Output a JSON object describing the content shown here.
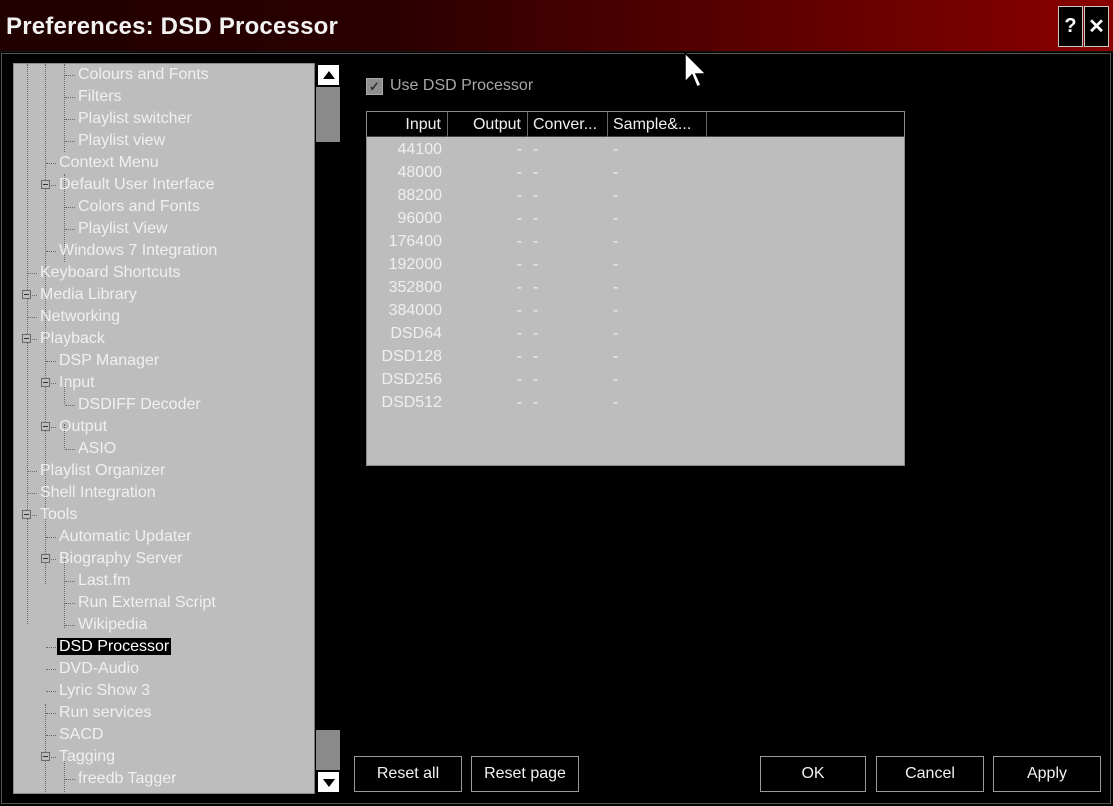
{
  "window": {
    "title": "Preferences: DSD Processor",
    "help_label": "?",
    "close_label": "✕"
  },
  "tree": {
    "items": [
      {
        "label": "Colours and Fonts",
        "selected": false
      },
      {
        "label": "Filters",
        "selected": false
      },
      {
        "label": "Playlist switcher",
        "selected": false
      },
      {
        "label": "Playlist view",
        "selected": false
      },
      {
        "label": "Context Menu",
        "selected": false
      },
      {
        "label": "Default User Interface",
        "selected": false
      },
      {
        "label": "Colors and Fonts",
        "selected": false
      },
      {
        "label": "Playlist View",
        "selected": false
      },
      {
        "label": "Windows 7 Integration",
        "selected": false
      },
      {
        "label": "Keyboard Shortcuts",
        "selected": false
      },
      {
        "label": "Media Library",
        "selected": false
      },
      {
        "label": "Networking",
        "selected": false
      },
      {
        "label": "Playback",
        "selected": false
      },
      {
        "label": "DSP Manager",
        "selected": false
      },
      {
        "label": "Input",
        "selected": false
      },
      {
        "label": "DSDIFF Decoder",
        "selected": false
      },
      {
        "label": "Output",
        "selected": false
      },
      {
        "label": "ASIO",
        "selected": false
      },
      {
        "label": "Playlist Organizer",
        "selected": false
      },
      {
        "label": "Shell Integration",
        "selected": false
      },
      {
        "label": "Tools",
        "selected": false
      },
      {
        "label": "Automatic Updater",
        "selected": false
      },
      {
        "label": "Biography Server",
        "selected": false
      },
      {
        "label": "Last.fm",
        "selected": false
      },
      {
        "label": "Run External Script",
        "selected": false
      },
      {
        "label": "Wikipedia",
        "selected": false
      },
      {
        "label": "DSD Processor",
        "selected": true
      },
      {
        "label": "DVD-Audio",
        "selected": false
      },
      {
        "label": "Lyric Show 3",
        "selected": false
      },
      {
        "label": "Run services",
        "selected": false
      },
      {
        "label": "SACD",
        "selected": false
      },
      {
        "label": "Tagging",
        "selected": false
      },
      {
        "label": "freedb Tagger",
        "selected": false
      }
    ]
  },
  "settings": {
    "use_dsd_label": "Use DSD Processor",
    "use_dsd_checked": true
  },
  "table": {
    "headers": {
      "input": "Input",
      "output": "Output",
      "conv": "Conver...",
      "samp": "Sample&..."
    },
    "rows": [
      {
        "input": "44100",
        "output": "-",
        "conv": "-",
        "samp": "-"
      },
      {
        "input": "48000",
        "output": "-",
        "conv": "-",
        "samp": "-"
      },
      {
        "input": "88200",
        "output": "-",
        "conv": "-",
        "samp": "-"
      },
      {
        "input": "96000",
        "output": "-",
        "conv": "-",
        "samp": "-"
      },
      {
        "input": "176400",
        "output": "-",
        "conv": "-",
        "samp": "-"
      },
      {
        "input": "192000",
        "output": "-",
        "conv": "-",
        "samp": "-"
      },
      {
        "input": "352800",
        "output": "-",
        "conv": "-",
        "samp": "-"
      },
      {
        "input": "384000",
        "output": "-",
        "conv": "-",
        "samp": "-"
      },
      {
        "input": "DSD64",
        "output": "-",
        "conv": "-",
        "samp": "-"
      },
      {
        "input": "DSD128",
        "output": "-",
        "conv": "-",
        "samp": "-"
      },
      {
        "input": "DSD256",
        "output": "-",
        "conv": "-",
        "samp": "-"
      },
      {
        "input": "DSD512",
        "output": "-",
        "conv": "-",
        "samp": "-"
      }
    ]
  },
  "buttons": {
    "reset_all": "Reset all",
    "reset_page": "Reset page",
    "ok": "OK",
    "cancel": "Cancel",
    "apply": "Apply"
  },
  "colors": {
    "titlebar_start": "#200000",
    "titlebar_end": "#8a0000",
    "tree_bg": "#bdbdbd",
    "selection_bg": "#000000"
  }
}
